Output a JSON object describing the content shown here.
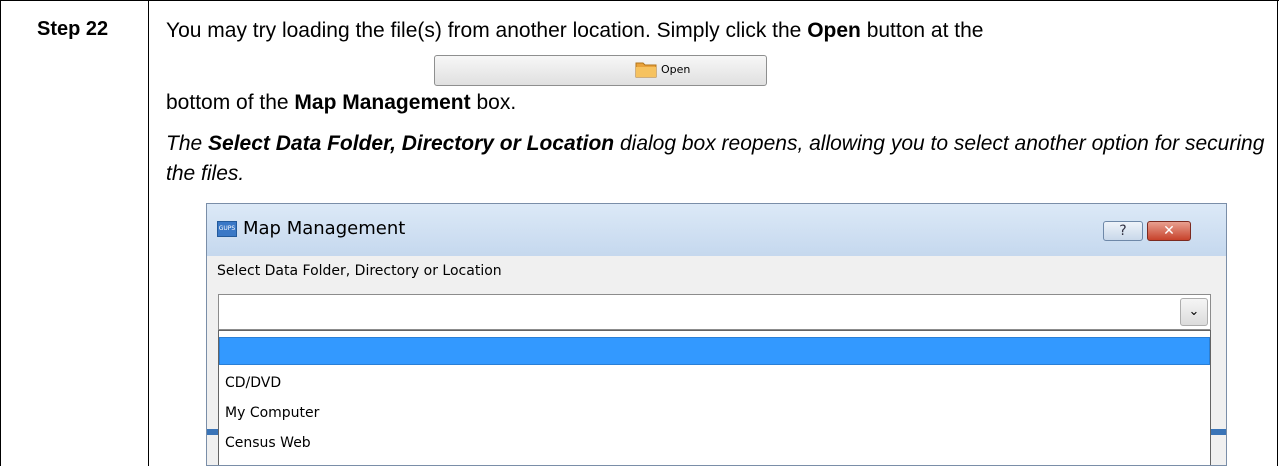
{
  "step": {
    "label": "Step 22",
    "text_part1": "You may try loading the file(s) from another location. Simply click the ",
    "open_bold": "Open",
    "text_part2": " button at the",
    "text_part3": "bottom of the ",
    "map_mgmt_bold": "Map Management",
    "text_part4": " box.",
    "open_button_label": "Open",
    "result_part1": "The ",
    "result_bold": "Select Data Folder, Directory or Location",
    "result_part2": " dialog box reopens, allowing you to select another option for securing the files."
  },
  "dialog": {
    "icon_text": "GUPS",
    "title": "Map Management",
    "help_label": "?",
    "close_label": "✕",
    "field_label": "Select Data Folder, Directory or Location",
    "combo_value": "",
    "combo_arrow": "⌄",
    "options": [
      "",
      "CD/DVD",
      "My Computer",
      "Census Web"
    ],
    "selected_index": 0
  },
  "colors": {
    "selection": "#3399ff",
    "close_button": "#c7422b",
    "titlebar": "#c5d8ee"
  }
}
